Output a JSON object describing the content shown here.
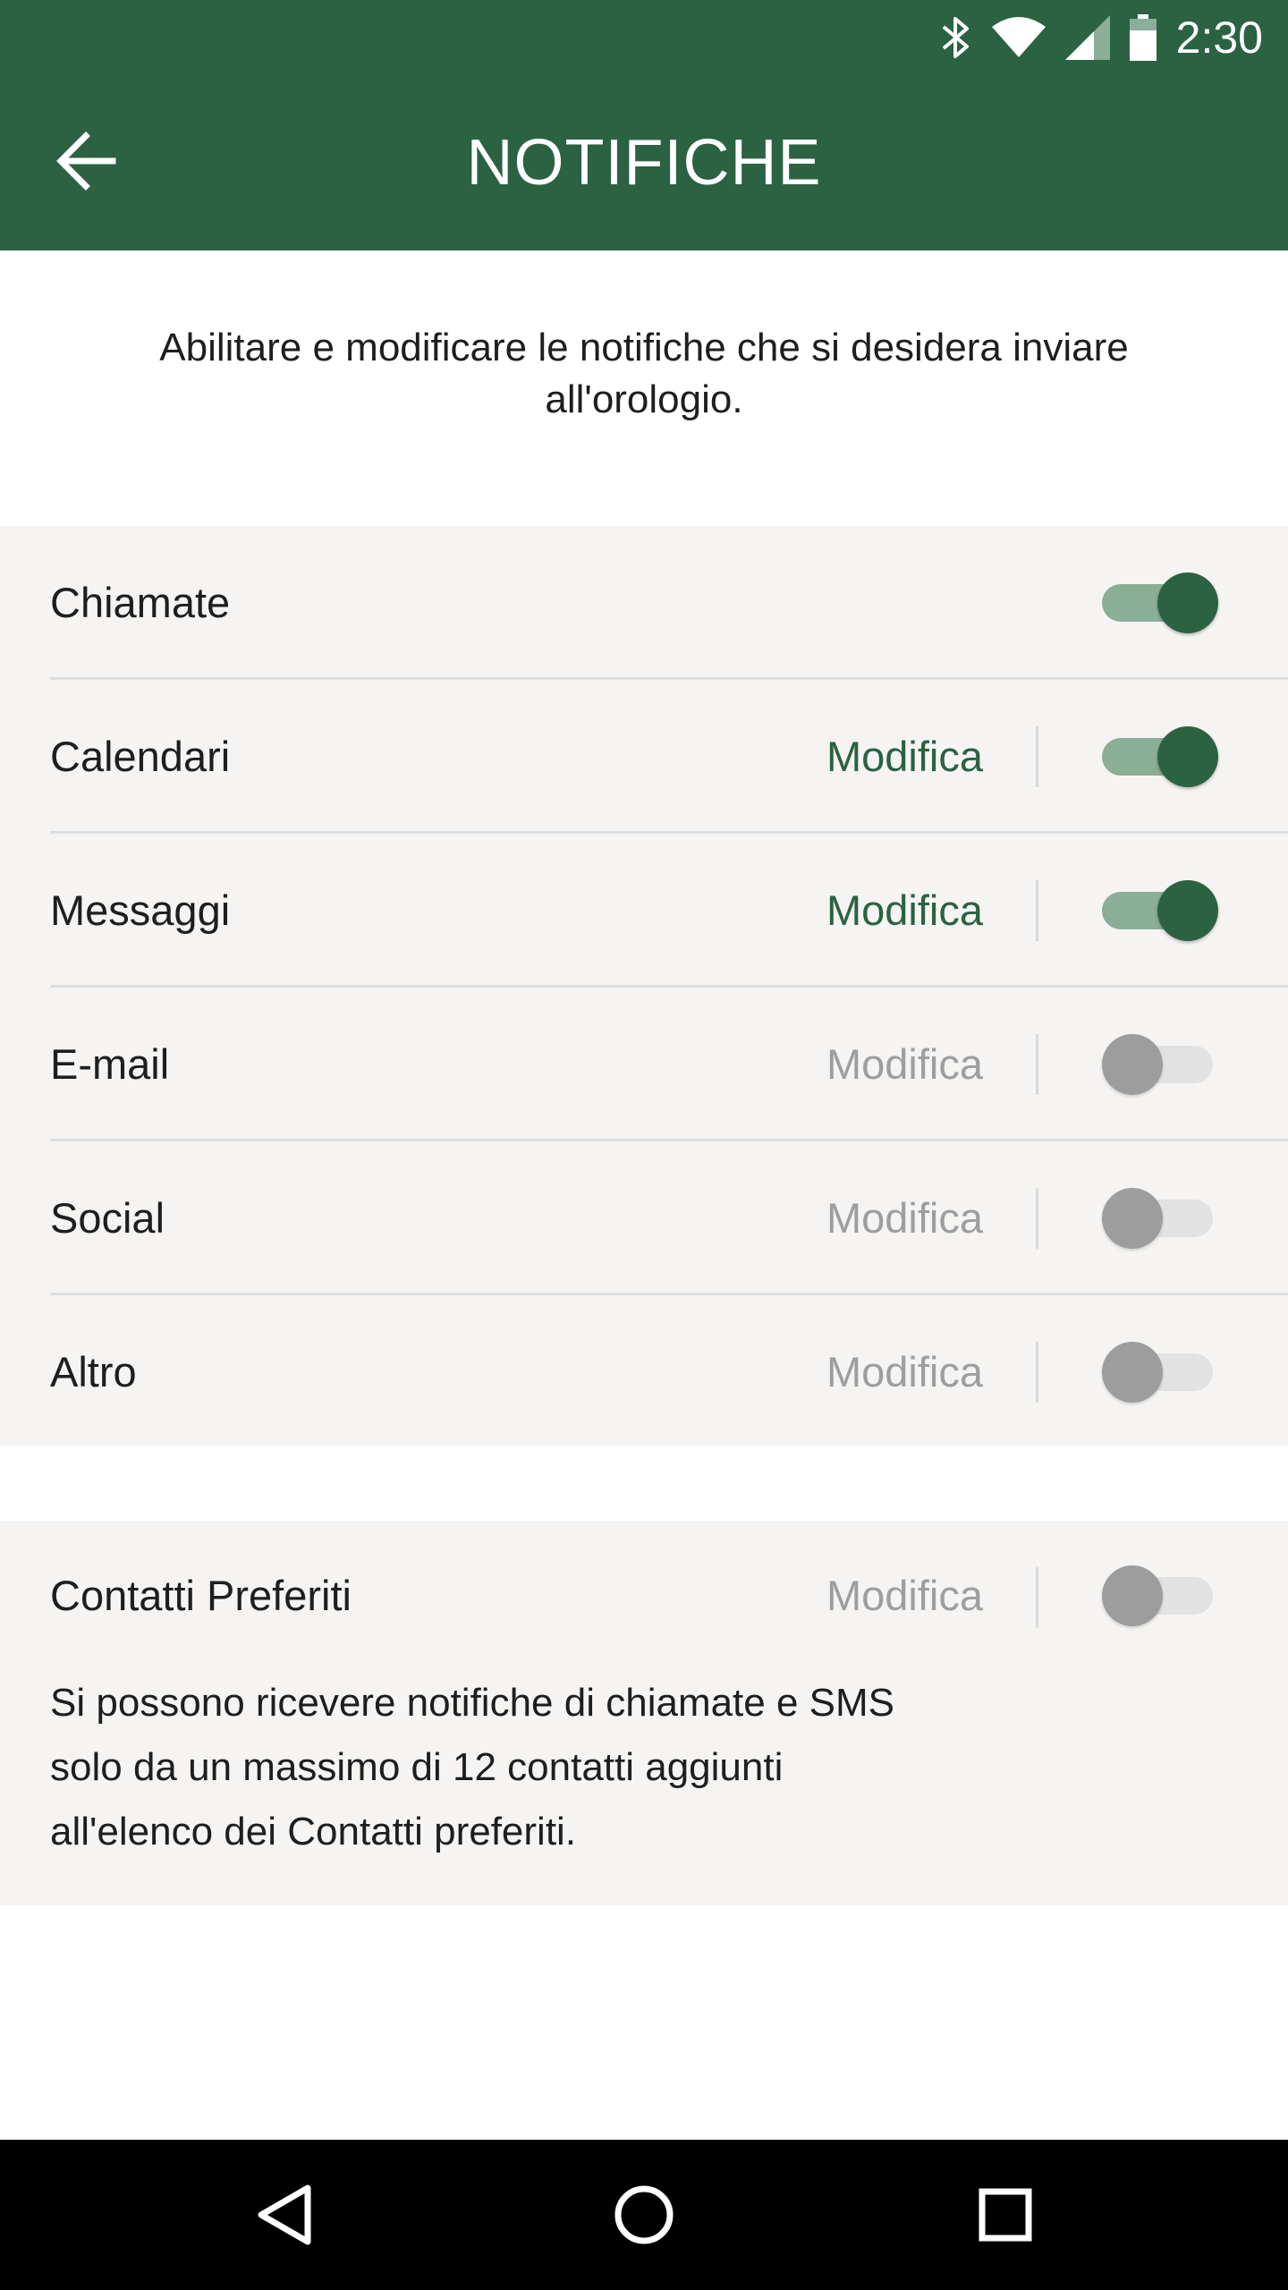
{
  "status_bar": {
    "time": "2:30",
    "icons": [
      "bluetooth-icon",
      "wifi-icon",
      "signal-icon",
      "battery-icon"
    ]
  },
  "header": {
    "title": "NOTIFICHE",
    "back_icon": "arrow-left-icon"
  },
  "intro": {
    "text": "Abilitare e modificare le notifiche che si desidera inviare all'orologio."
  },
  "notifications": [
    {
      "label": "Chiamate",
      "edit_label": "",
      "enabled": true
    },
    {
      "label": "Calendari",
      "edit_label": "Modifica",
      "enabled": true
    },
    {
      "label": "Messaggi",
      "edit_label": "Modifica",
      "enabled": true
    },
    {
      "label": "E-mail",
      "edit_label": "Modifica",
      "enabled": false
    },
    {
      "label": "Social",
      "edit_label": "Modifica",
      "enabled": false
    },
    {
      "label": "Altro",
      "edit_label": "Modifica",
      "enabled": false
    }
  ],
  "favorites": {
    "label": "Contatti Preferiti",
    "edit_label": "Modifica",
    "enabled": false,
    "description": "Si possono ricevere notifiche di chiamate e SMS solo da un massimo di 12 contatti aggiunti all'elenco dei Contatti preferiti."
  },
  "nav_bar": {
    "icons": [
      "back-triangle-icon",
      "home-circle-icon",
      "recents-square-icon"
    ]
  },
  "colors": {
    "primary": "#2b6242",
    "toggle_on_track": "#8aae98",
    "toggle_off_thumb": "#9d9d9d",
    "toggle_off_track": "#e2e2e2",
    "panel_bg": "#f5f4f2",
    "edit_inactive": "#9e9e9e"
  }
}
